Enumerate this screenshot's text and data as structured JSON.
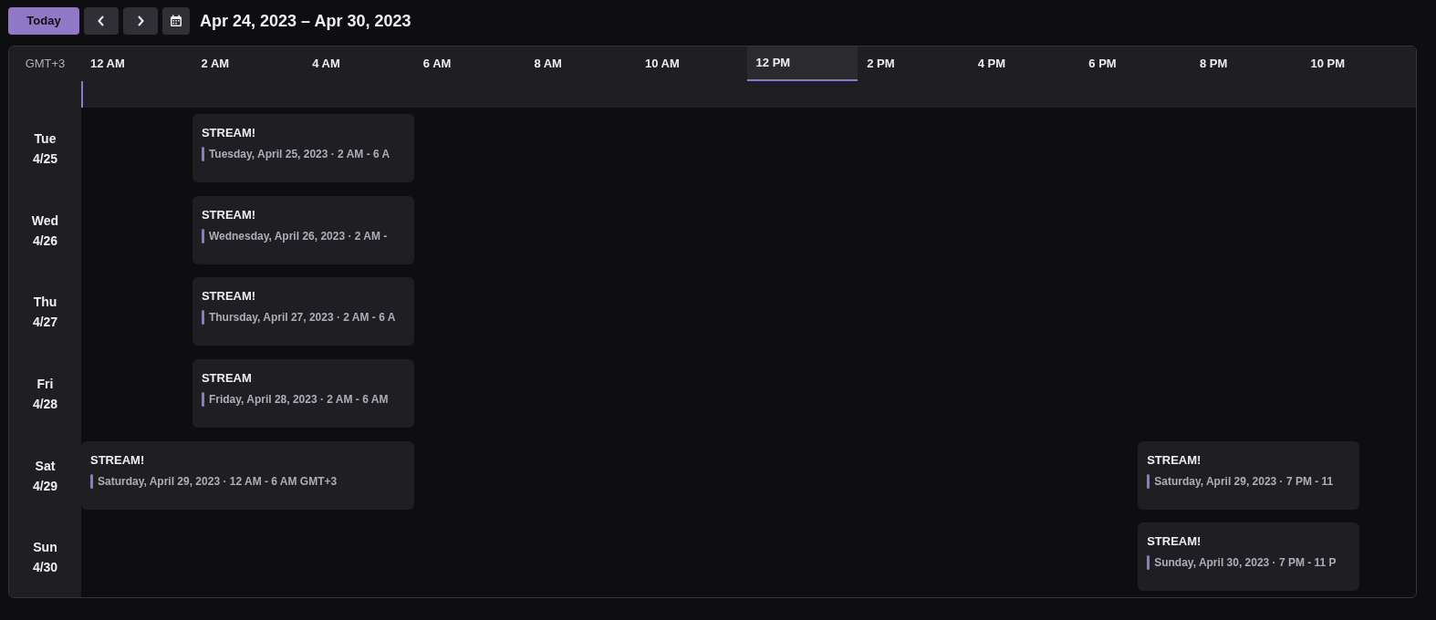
{
  "toolbar": {
    "today_button": "Today",
    "range_title": "Apr 24, 2023 – Apr 30, 2023"
  },
  "header": {
    "timezone": "GMT+3",
    "hours": [
      {
        "label": "12 AM",
        "selected": false
      },
      {
        "label": "2 AM",
        "selected": false
      },
      {
        "label": "4 AM",
        "selected": false
      },
      {
        "label": "6 AM",
        "selected": false
      },
      {
        "label": "8 AM",
        "selected": false
      },
      {
        "label": "10 AM",
        "selected": false
      },
      {
        "label": "12 PM",
        "selected": true
      },
      {
        "label": "2 PM",
        "selected": false
      },
      {
        "label": "4 PM",
        "selected": false
      },
      {
        "label": "6 PM",
        "selected": false
      },
      {
        "label": "8 PM",
        "selected": false
      },
      {
        "label": "10 PM",
        "selected": false
      }
    ]
  },
  "days": [
    {
      "weekday": "Tue",
      "date": "4/25",
      "events": [
        {
          "title": "STREAM!",
          "details": "Tuesday, April 25, 2023 · 2 AM - 6 A"
        }
      ]
    },
    {
      "weekday": "Wed",
      "date": "4/26",
      "events": [
        {
          "title": "STREAM!",
          "details": "Wednesday, April 26, 2023 · 2 AM -"
        }
      ]
    },
    {
      "weekday": "Thu",
      "date": "4/27",
      "events": [
        {
          "title": "STREAM!",
          "details": "Thursday, April 27, 2023 · 2 AM - 6 A"
        }
      ]
    },
    {
      "weekday": "Fri",
      "date": "4/28",
      "events": [
        {
          "title": "STREAM",
          "details": "Friday, April 28, 2023 · 2 AM - 6 AM"
        }
      ]
    },
    {
      "weekday": "Sat",
      "date": "4/29",
      "events": [
        {
          "title": "STREAM!",
          "details": "Saturday, April 29, 2023 · 12 AM - 6 AM GMT+3"
        },
        {
          "title": "STREAM!",
          "details": "Saturday, April 29, 2023 · 7 PM - 11"
        }
      ]
    },
    {
      "weekday": "Sun",
      "date": "4/30",
      "events": [
        {
          "title": "STREAM!",
          "details": "Sunday, April 30, 2023 · 7 PM - 11 P"
        }
      ]
    }
  ]
}
